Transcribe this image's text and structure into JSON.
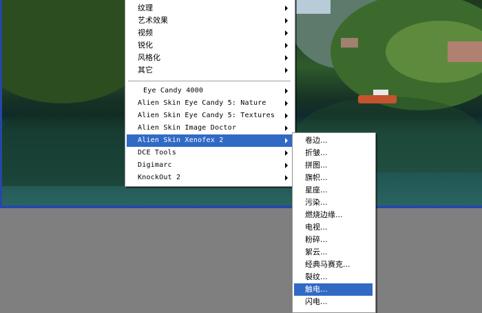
{
  "menu_main": {
    "top_items": [
      {
        "label": "纹理"
      },
      {
        "label": "艺术效果"
      },
      {
        "label": "视频"
      },
      {
        "label": "锐化"
      },
      {
        "label": "风格化"
      },
      {
        "label": "其它"
      }
    ],
    "plugin_items": [
      {
        "label": "Eye Candy 4000"
      },
      {
        "label": "Alien Skin Eye Candy 5: Nature"
      },
      {
        "label": "Alien Skin Eye Candy 5: Textures"
      },
      {
        "label": "Alien Skin Image Doctor"
      },
      {
        "label": "Alien Skin Xenofex 2",
        "selected": true
      },
      {
        "label": "DCE Tools"
      },
      {
        "label": "Digimarc"
      },
      {
        "label": "KnockOut 2"
      }
    ]
  },
  "submenu_xenofex": {
    "items": [
      {
        "label": "卷边..."
      },
      {
        "label": "折皱..."
      },
      {
        "label": "拼图..."
      },
      {
        "label": "旗帜..."
      },
      {
        "label": "星座..."
      },
      {
        "label": "污染..."
      },
      {
        "label": "燃烧边缘..."
      },
      {
        "label": "电视..."
      },
      {
        "label": "粉碎..."
      },
      {
        "label": "絮云..."
      },
      {
        "label": "经典马赛克..."
      },
      {
        "label": "裂纹..."
      },
      {
        "label": "触电...",
        "selected": true
      },
      {
        "label": "闪电..."
      }
    ]
  },
  "colors": {
    "highlight": "#316ac5",
    "workspace": "#7f7f7f",
    "canvas_border": "#2647a8"
  }
}
